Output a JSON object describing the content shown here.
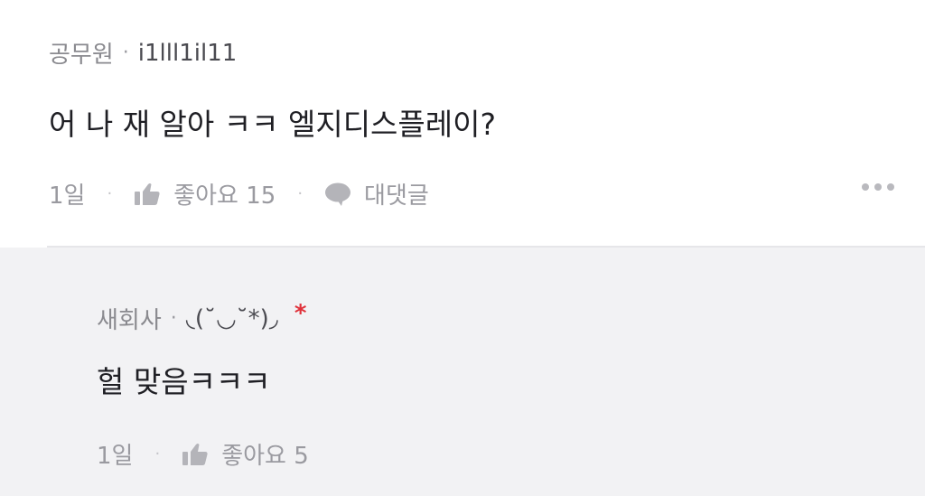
{
  "comment": {
    "category": "공무원",
    "separator": "·",
    "nickname": "i1lll1il11",
    "text": "어 나 재 알아 ㅋㅋ 엘지디스플레이?",
    "time": "1일",
    "like_label": "좋아요 15",
    "reply_label": "대댓글",
    "action_separator": "·"
  },
  "reply": {
    "category": "새회사",
    "separator": "·",
    "nickname": "◟(˘◡˘*)◞",
    "badge": "*",
    "text": "헐 맞음ㅋㅋㅋ",
    "time": "1일",
    "like_label": "좋아요 5",
    "action_separator": "·"
  },
  "colors": {
    "reply_background": "#f2f2f4",
    "badge_red": "#e0313a",
    "muted_text": "#9a9aa0"
  },
  "icons": [
    "thumbs-up-icon",
    "speech-bubble-icon",
    "more-dots-icon"
  ]
}
